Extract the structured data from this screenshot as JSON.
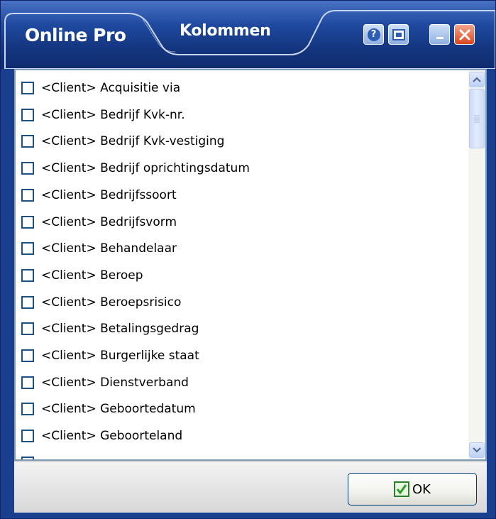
{
  "window": {
    "app_title": "Online Pro",
    "dialog_title": "Kolommen",
    "buttons": {
      "help_icon": "help-icon",
      "screenshot_icon": "screenshot-icon",
      "minimize_icon": "minimize-icon",
      "close_icon": "close-icon"
    },
    "colors": {
      "titlebar": "#1f4aa0",
      "close_button": "#d9461f",
      "checkbox_border": "#1c5180"
    }
  },
  "column_list": {
    "items": [
      {
        "label": "<Client> Acquisitie via",
        "checked": false
      },
      {
        "label": "<Client> Bedrijf Kvk-nr.",
        "checked": false
      },
      {
        "label": "<Client> Bedrijf Kvk-vestiging",
        "checked": false
      },
      {
        "label": "<Client> Bedrijf oprichtingsdatum",
        "checked": false
      },
      {
        "label": "<Client> Bedrijfssoort",
        "checked": false
      },
      {
        "label": "<Client> Bedrijfsvorm",
        "checked": false
      },
      {
        "label": "<Client> Behandelaar",
        "checked": false
      },
      {
        "label": "<Client> Beroep",
        "checked": false
      },
      {
        "label": "<Client> Beroepsrisico",
        "checked": false
      },
      {
        "label": "<Client> Betalingsgedrag",
        "checked": false
      },
      {
        "label": "<Client> Burgerlijke staat",
        "checked": false
      },
      {
        "label": "<Client> Dienstverband",
        "checked": false
      },
      {
        "label": "<Client> Geboortedatum",
        "checked": false
      },
      {
        "label": "<Client> Geboorteland",
        "checked": false
      }
    ]
  },
  "footer": {
    "ok_label": "OK"
  }
}
